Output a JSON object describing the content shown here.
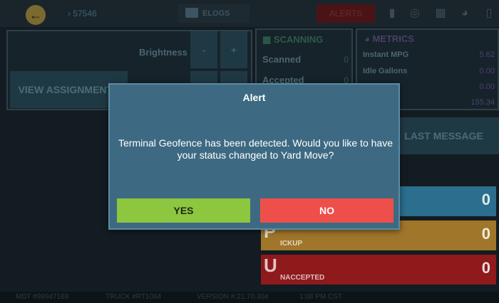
{
  "topbar": {
    "back_icon": "back-arrow-icon",
    "mdt_number": "› 57546",
    "elogs_label": "ELOGS",
    "alerts_label": "ALERTS",
    "icons": [
      "signal-icon",
      "globe-icon",
      "printer-icon",
      "gauge-icon",
      "device-icon"
    ]
  },
  "brightness": {
    "label": "Brightness",
    "minus": "-",
    "plus": "+"
  },
  "view_assignments_label": "VIEW ASSIGNMENTS",
  "scanning": {
    "title": "SCANNING",
    "rows": [
      {
        "label": "Scanned",
        "value": "0"
      },
      {
        "label": "Accepted",
        "value": "0"
      }
    ]
  },
  "metrics": {
    "title": "METRICS",
    "rows": [
      {
        "label": "Instant MPG",
        "value": "5.62"
      },
      {
        "label": "Idle Gallons",
        "value": "0.00"
      },
      {
        "label": "",
        "value": "0.00"
      },
      {
        "label": "",
        "value": "155.34"
      }
    ]
  },
  "last_message_label": "LAST MESSAGE",
  "tiles": [
    {
      "letter": "",
      "sub": "",
      "count": "0",
      "color": "#2b6e8d"
    },
    {
      "letter": "P",
      "sub": "ICKUP",
      "count": "0",
      "color": "#a0762a"
    },
    {
      "letter": "U",
      "sub": "NACCEPTED",
      "count": "0",
      "color": "#8e1a1c"
    }
  ],
  "statusbar": {
    "mdt": "MDT #99947169",
    "truck": "TRUCK #RT1064",
    "version": "VERSION #:21.70.304",
    "time": "1:08 PM CST"
  },
  "alert": {
    "title": "Alert",
    "message": "Terminal Geofence has been detected. Would you like to have your status changed to Yard Move?",
    "yes_label": "YES",
    "no_label": "NO"
  },
  "colors": {
    "modal_bg": "#3d6a82",
    "yes": "#8dc63f",
    "no": "#ef4f4a"
  }
}
